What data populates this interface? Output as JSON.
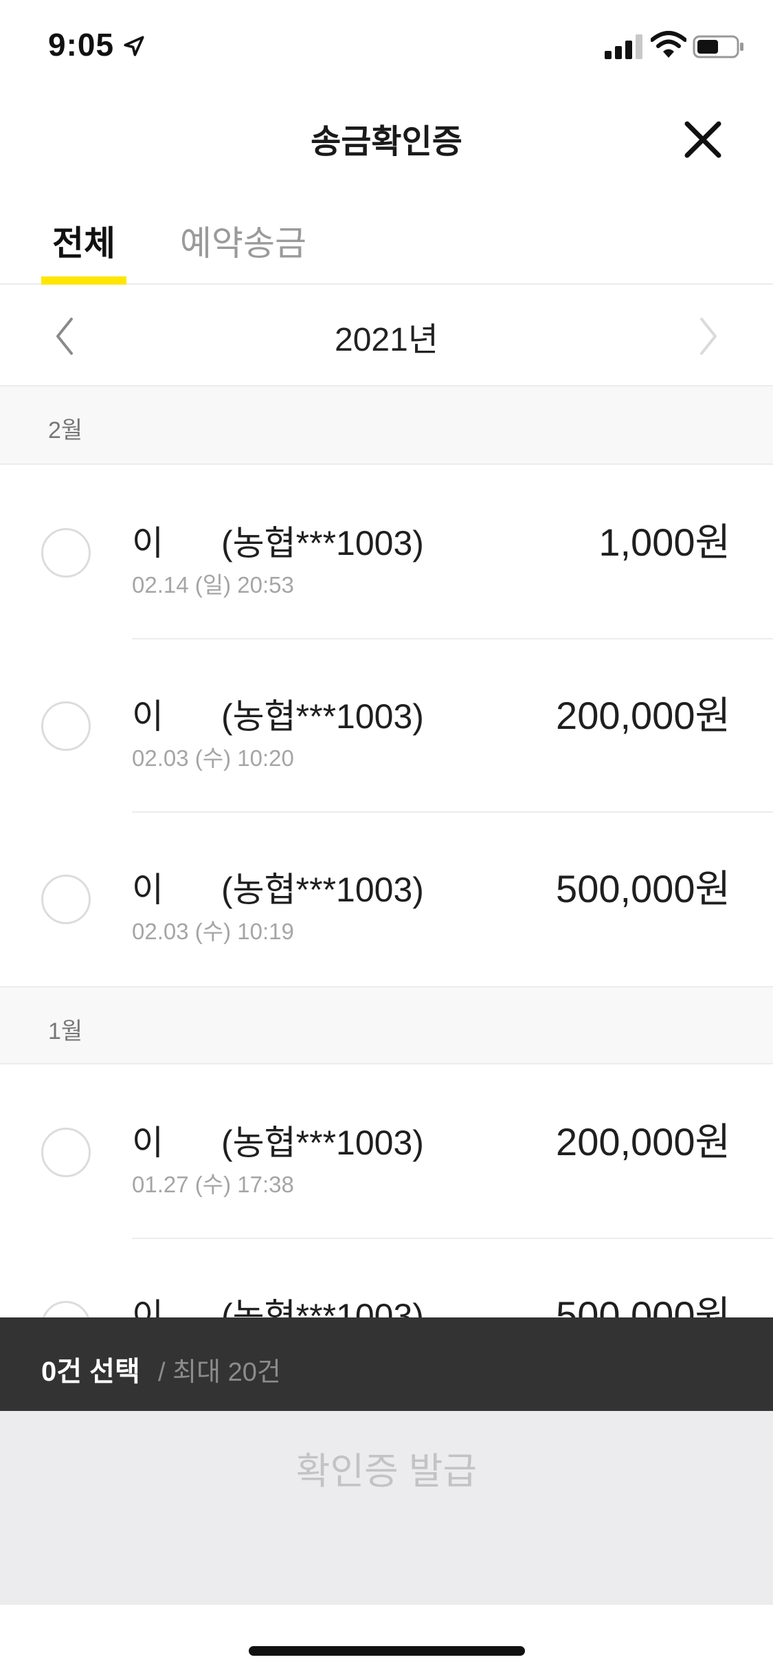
{
  "status_bar": {
    "time": "9:05"
  },
  "header": {
    "title": "송금확인증"
  },
  "tabs": [
    {
      "label": "전체",
      "active": true
    },
    {
      "label": "예약송금",
      "active": false
    }
  ],
  "year_nav": {
    "year": "2021년"
  },
  "months": [
    {
      "label": "2월",
      "transfers": [
        {
          "name": "이",
          "account": "(농협***1003)",
          "date": "02.14 (일) 20:53",
          "amount": "1,000원"
        },
        {
          "name": "이",
          "account": "(농협***1003)",
          "date": "02.03 (수) 10:20",
          "amount": "200,000원"
        },
        {
          "name": "이",
          "account": "(농협***1003)",
          "date": "02.03 (수) 10:19",
          "amount": "500,000원"
        }
      ]
    },
    {
      "label": "1월",
      "transfers": [
        {
          "name": "이",
          "account": "(농협***1003)",
          "date": "01.27 (수) 17:38",
          "amount": "200,000원"
        },
        {
          "name": "이",
          "account": "(농협***1003)",
          "date": "",
          "amount": "500,000원"
        }
      ]
    }
  ],
  "selection_bar": {
    "count": "0건 선택",
    "max": "/ 최대 20건"
  },
  "issue_button": {
    "label": "확인증 발급",
    "enabled": false
  },
  "colors": {
    "accent": "#ffe600",
    "selection_bar_bg": "#333333",
    "issue_area_bg": "#ececee"
  },
  "icons": {
    "back": "chevron-left-icon",
    "forward": "chevron-right-icon",
    "close": "close-icon"
  }
}
